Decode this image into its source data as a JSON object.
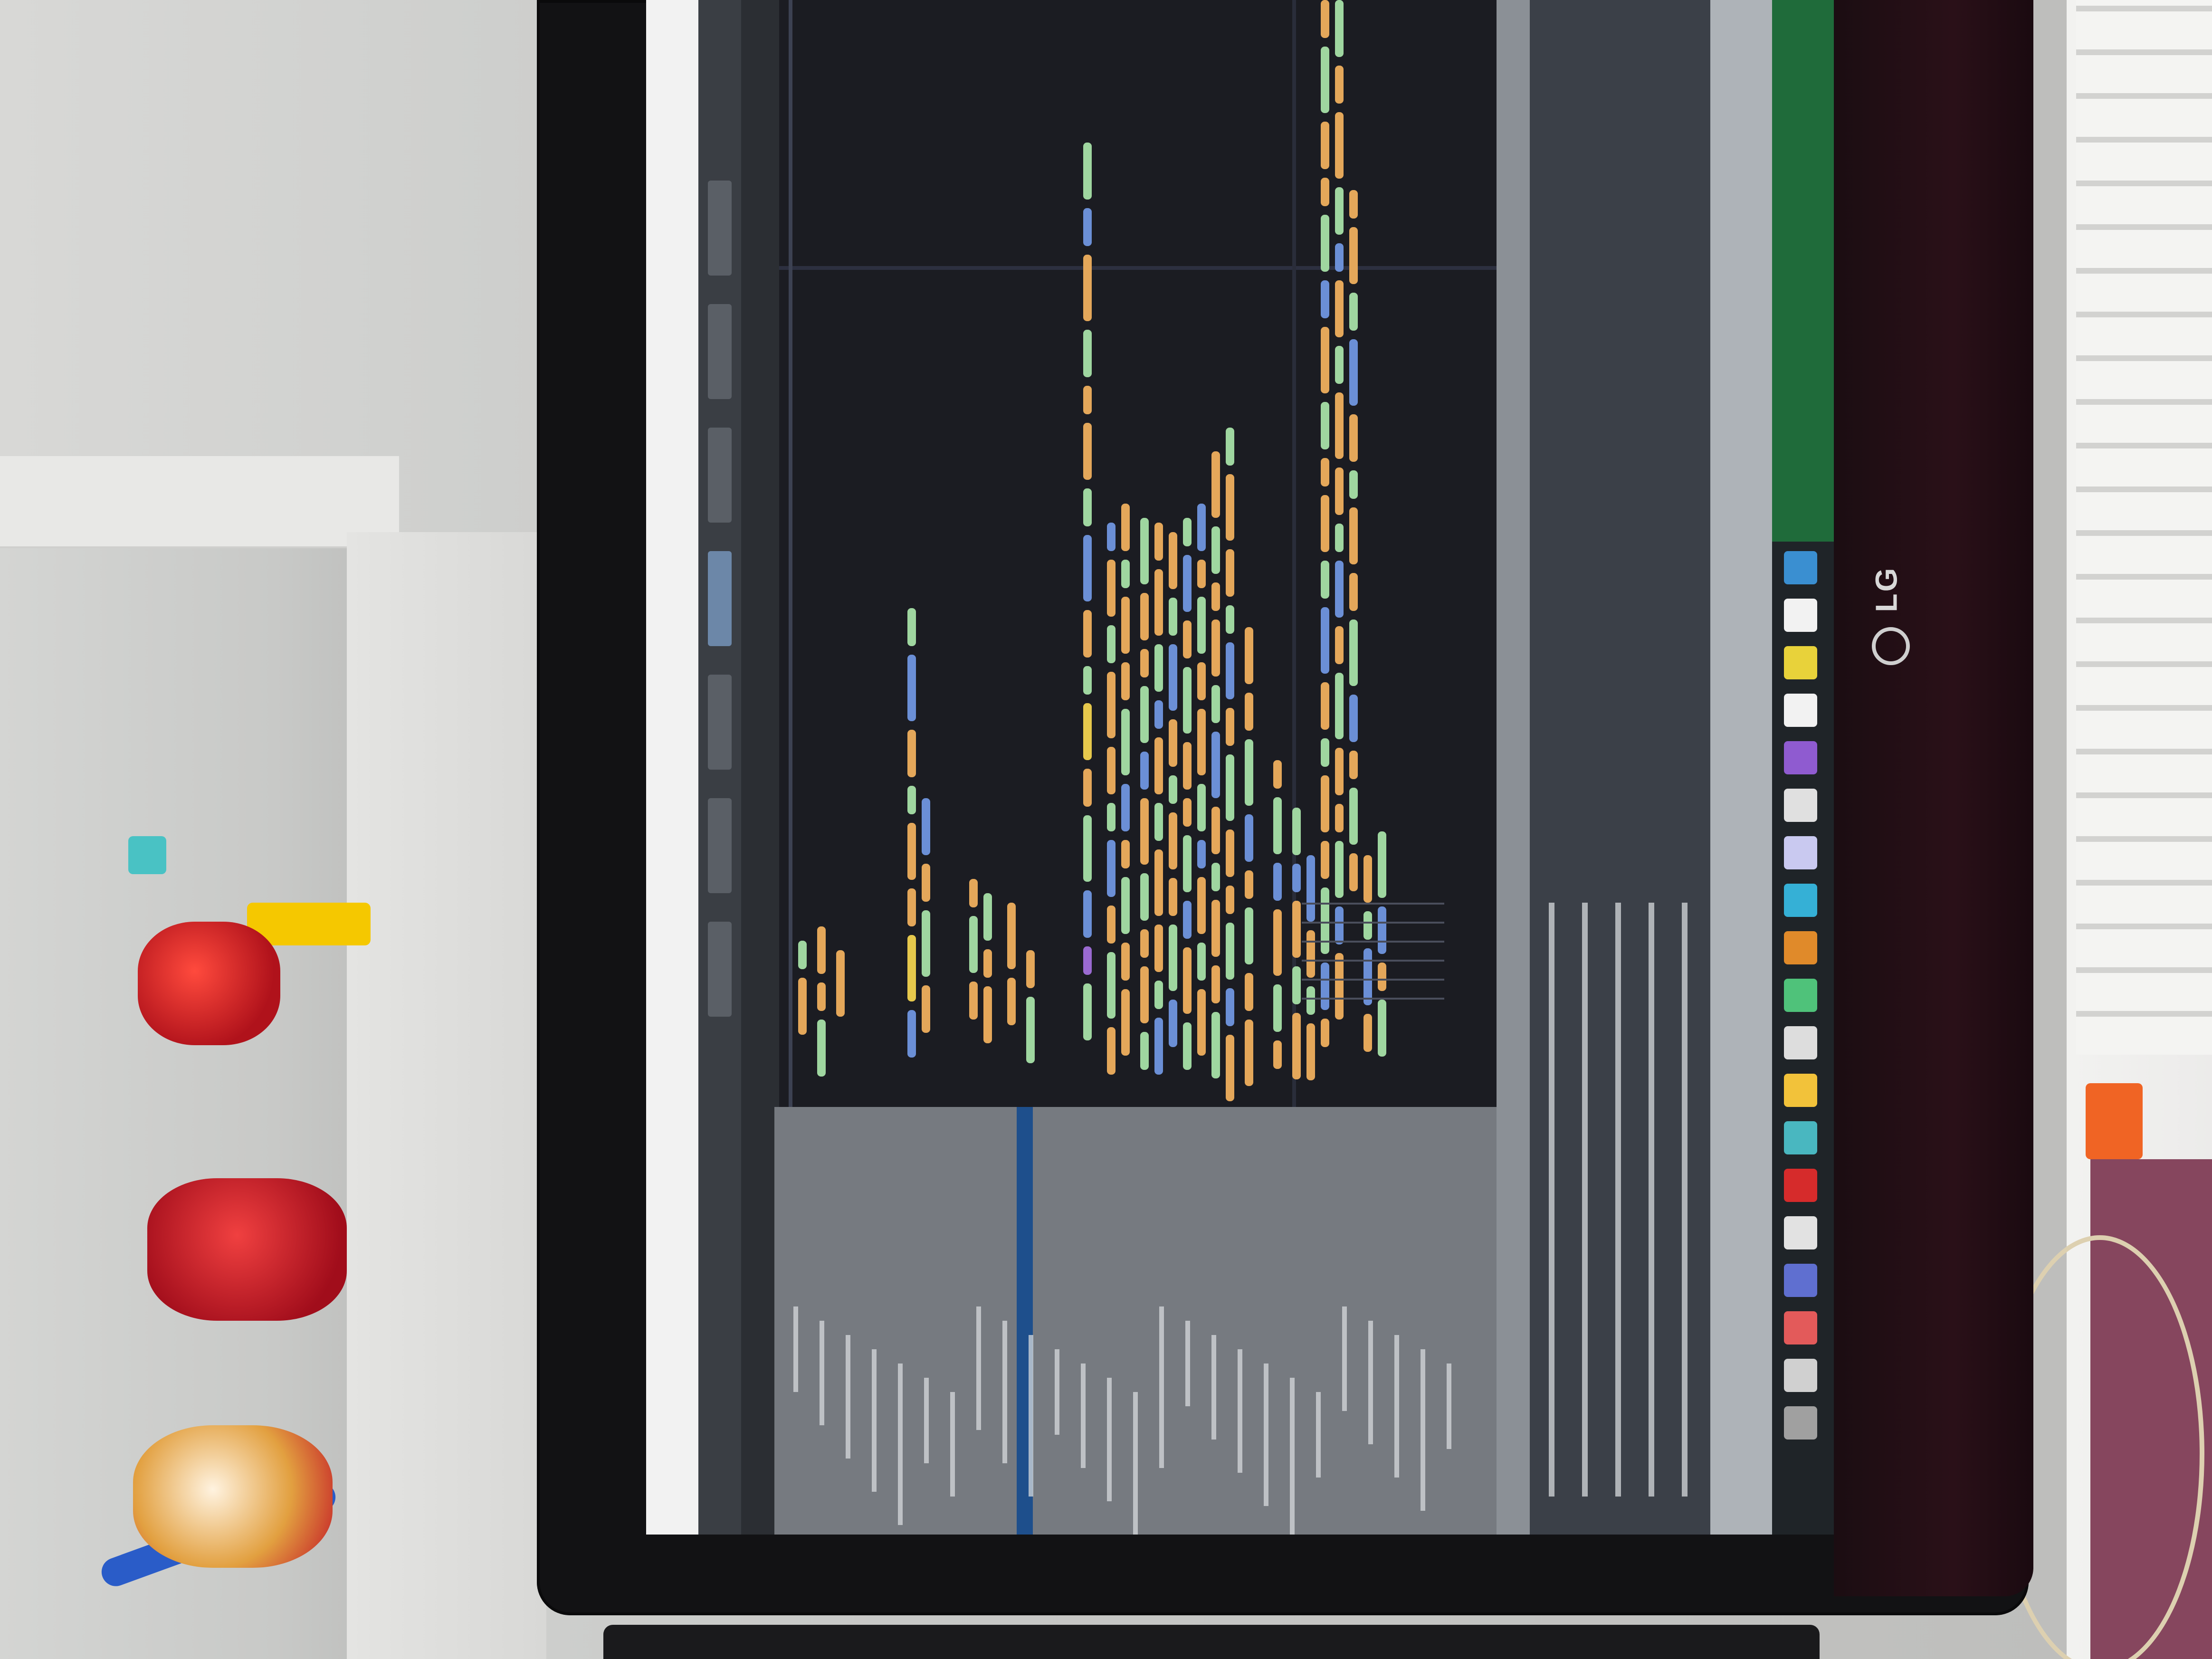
{
  "monitor": {
    "brand": "LG"
  },
  "colors": {
    "graph_background": "#1b1c22",
    "node_green": "#9fd6a0",
    "node_orange": "#e4a75a",
    "node_blue": "#6b8fd6",
    "node_purple": "#9a6ad1",
    "node_yellow": "#e6c84c",
    "taskbar_green": "#1f6b3a",
    "panel_dark": "#3b4048",
    "panel_light": "#aeb3b8"
  }
}
